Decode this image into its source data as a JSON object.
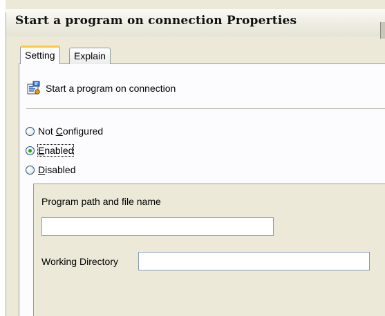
{
  "window": {
    "title": "Start a program on connection Properties"
  },
  "tabs": [
    {
      "label": "Setting",
      "selected": true
    },
    {
      "label": "Explain",
      "selected": false
    }
  ],
  "policy": {
    "name": "Start a program on connection",
    "icon": "policy-setting-icon"
  },
  "options": {
    "not_configured": {
      "label_pre": "Not ",
      "label_key": "C",
      "label_post": "onfigured",
      "checked": false
    },
    "enabled": {
      "label_pre": "",
      "label_key": "E",
      "label_post": "nabled",
      "checked": true
    },
    "disabled": {
      "label_pre": "",
      "label_key": "D",
      "label_post": "isabled",
      "checked": false
    }
  },
  "fields": {
    "program_path": {
      "label": "Program path and file name",
      "value": ""
    },
    "working_directory": {
      "label": "Working Directory",
      "value": ""
    }
  },
  "colors": {
    "tab_highlight": "#ffc83c",
    "radio_dot": "#21a121",
    "textbox_border": "#7f9db9"
  }
}
